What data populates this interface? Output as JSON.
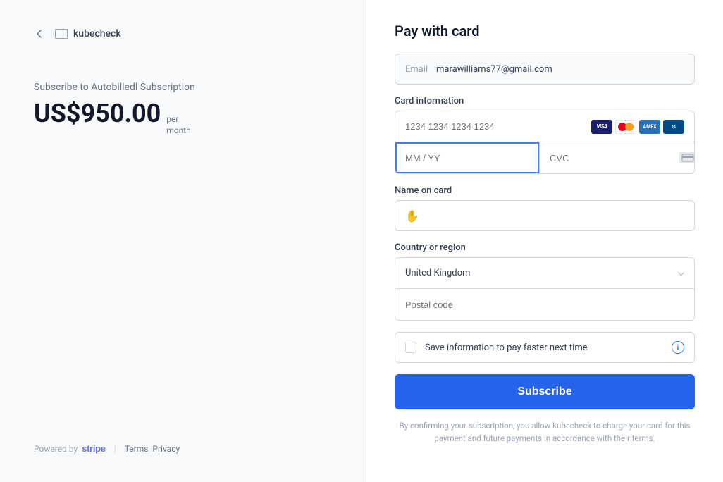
{
  "left": {
    "back_aria": "back",
    "tab_aria": "browser-tab",
    "brand": "kubecheck",
    "subscribe_title": "Subscribe to Autobilledl Subscription",
    "price": "US$950.00",
    "per_label": "per\nmonth",
    "powered_by": "Powered by",
    "stripe": "stripe",
    "terms": "Terms",
    "privacy": "Privacy"
  },
  "right": {
    "title": "Pay with card",
    "email_label": "Email",
    "email_value": "marawilliams77@gmail.com",
    "card_info_label": "Card information",
    "card_number_placeholder": "1234 1234 1234 1234",
    "mm_yy_placeholder": "MM / YY",
    "cvc_placeholder": "CVC",
    "name_label": "Name on card",
    "country_label": "Country or region",
    "country_value": "United Kingdom",
    "postal_placeholder": "Postal code",
    "save_info_text": "Save information to pay faster next time",
    "subscribe_btn": "Subscribe",
    "confirm_text": "By confirming your subscription, you allow kubecheck to charge your card for this payment and future payments in accordance with their terms."
  }
}
